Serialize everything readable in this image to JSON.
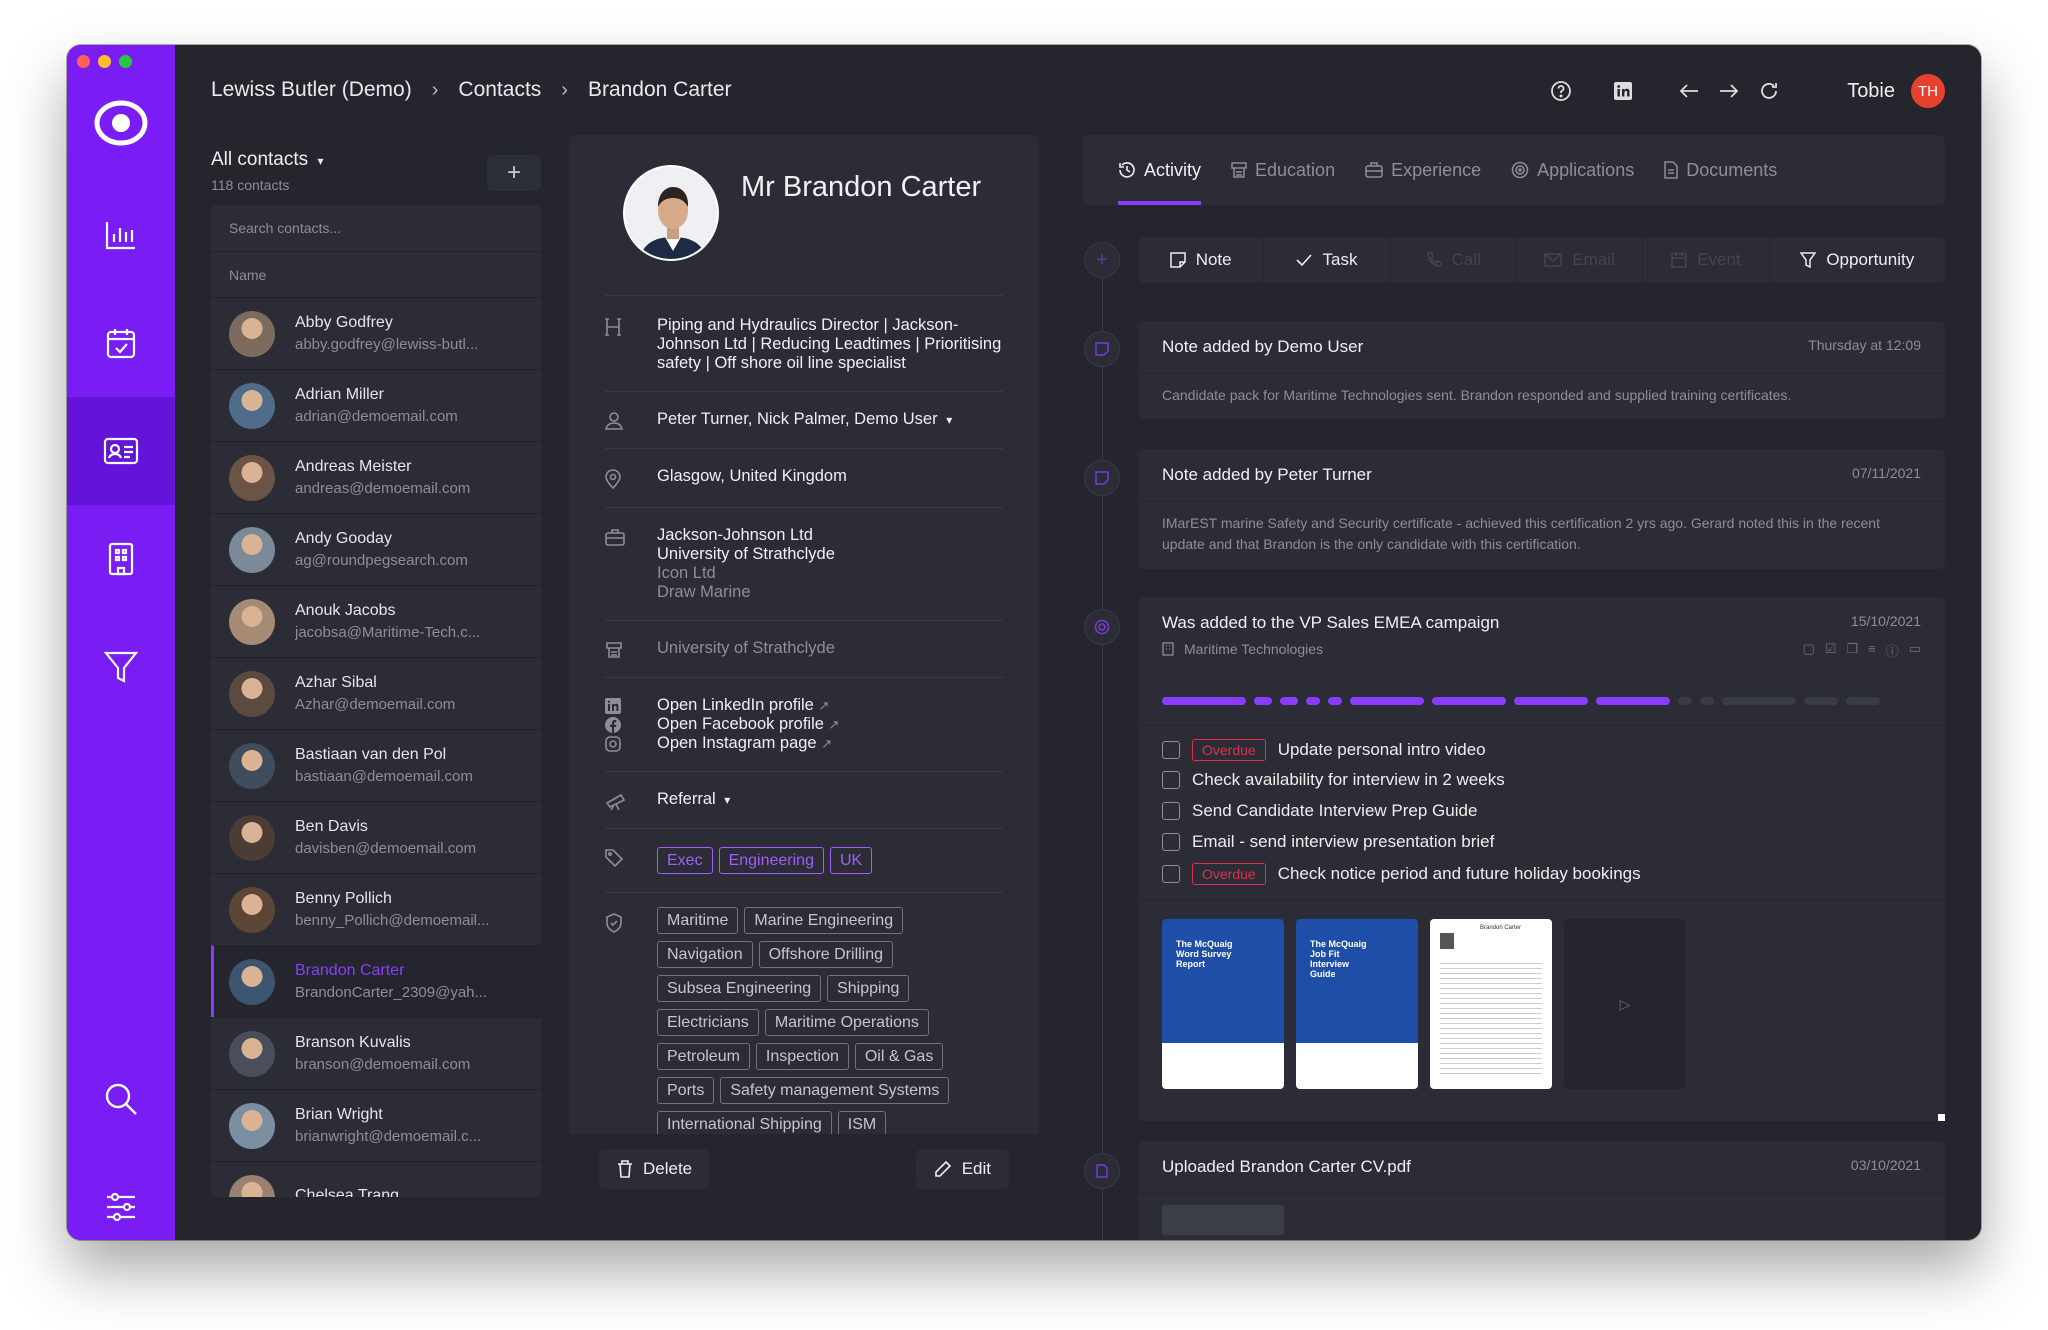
{
  "breadcrumb": [
    "Lewiss Butler (Demo)",
    "Contacts",
    "Brandon Carter"
  ],
  "user": {
    "name": "Tobie",
    "initials": "TH"
  },
  "colors": {
    "accent": "#8b3dff",
    "rail": "#7a1cf4",
    "overdue": "#e0314b"
  },
  "contacts": {
    "title": "All contacts",
    "count": "118 contacts",
    "search_placeholder": "Search contacts...",
    "column_name": "Name",
    "items": [
      {
        "name": "Abby Godfrey",
        "email": "abby.godfrey@lewiss-butl..."
      },
      {
        "name": "Adrian Miller",
        "email": "adrian@demoemail.com"
      },
      {
        "name": "Andreas Meister",
        "email": "andreas@demoemail.com"
      },
      {
        "name": "Andy Gooday",
        "email": "ag@roundpegsearch.com"
      },
      {
        "name": "Anouk Jacobs",
        "email": "jacobsa@Maritime-Tech.c..."
      },
      {
        "name": "Azhar Sibal",
        "email": "Azhar@demoemail.com"
      },
      {
        "name": "Bastiaan van den Pol",
        "email": "bastiaan@demoemail.com"
      },
      {
        "name": "Ben Davis",
        "email": "davisben@demoemail.com"
      },
      {
        "name": "Benny Pollich",
        "email": "benny_Pollich@demoemail..."
      },
      {
        "name": "Brandon Carter",
        "email": "BrandonCarter_2309@yah..."
      },
      {
        "name": "Branson Kuvalis",
        "email": "branson@demoemail.com"
      },
      {
        "name": "Brian Wright",
        "email": "brianwright@demoemail.c..."
      },
      {
        "name": "Chelsea Trang",
        "email": ""
      }
    ]
  },
  "profile": {
    "name": "Mr Brandon Carter",
    "headline": "Piping and Hydraulics Director | Jackson-Johnson Ltd | Reducing Leadtimes | Prioritising safety | Off shore oil line specialist",
    "owners": "Peter Turner, Nick Palmer, Demo User",
    "location": "Glasgow, United Kingdom",
    "employers": [
      "Jackson-Johnson Ltd",
      "University of Strathclyde",
      "Icon Ltd",
      "Draw Marine"
    ],
    "education": "University of Strathclyde",
    "links": [
      "Open LinkedIn profile",
      "Open Facebook profile",
      "Open Instagram page"
    ],
    "source": "Referral",
    "tags": [
      "Exec",
      "Engineering",
      "UK"
    ],
    "skills": [
      "Maritime",
      "Marine Engineering",
      "Navigation",
      "Offshore Drilling",
      "Subsea Engineering",
      "Shipping",
      "Electricians",
      "Maritime Operations",
      "Petroleum",
      "Inspection",
      "Oil & Gas",
      "Ports",
      "Safety management Systems",
      "International Shipping",
      "ISM"
    ],
    "delete_label": "Delete",
    "edit_label": "Edit"
  },
  "tabs": [
    "Activity",
    "Education",
    "Experience",
    "Applications",
    "Documents"
  ],
  "actions": [
    {
      "label": "Note",
      "enabled": true
    },
    {
      "label": "Task",
      "enabled": true
    },
    {
      "label": "Call",
      "enabled": false
    },
    {
      "label": "Email",
      "enabled": false
    },
    {
      "label": "Event",
      "enabled": false
    },
    {
      "label": "Opportunity",
      "enabled": true
    }
  ],
  "feed": {
    "note1": {
      "title": "Note added by Demo User",
      "date": "Thursday at 12:09",
      "body": "Candidate pack for Maritime Technologies sent. Brandon responded and supplied training certificates."
    },
    "note2": {
      "title": "Note added by Peter Turner",
      "date": "07/11/2021",
      "body": "IMarEST marine Safety and Security certificate - achieved this certification 2 yrs ago. Gerard noted this in the recent update and that Brandon is the only candidate with this certification."
    },
    "campaign": {
      "title": "Was added to the VP Sales EMEA campaign",
      "date": "15/10/2021",
      "company": "Maritime Technologies",
      "overdue_label": "Overdue",
      "tasks": [
        {
          "label": "Update personal intro video",
          "overdue": true
        },
        {
          "label": "Check availability for interview in 2 weeks",
          "overdue": false
        },
        {
          "label": "Send Candidate Interview Prep Guide",
          "overdue": false
        },
        {
          "label": "Email - send interview presentation brief",
          "overdue": false
        },
        {
          "label": "Check notice period and future holiday bookings",
          "overdue": true
        }
      ],
      "docs": [
        {
          "title": "The McQuaig Word Survey Report"
        },
        {
          "title": "The McQuaig Job Fit Interview Guide"
        },
        {
          "title": "Brandon Carter"
        }
      ]
    },
    "upload": {
      "title": "Uploaded Brandon Carter CV.pdf",
      "date": "03/10/2021"
    }
  }
}
